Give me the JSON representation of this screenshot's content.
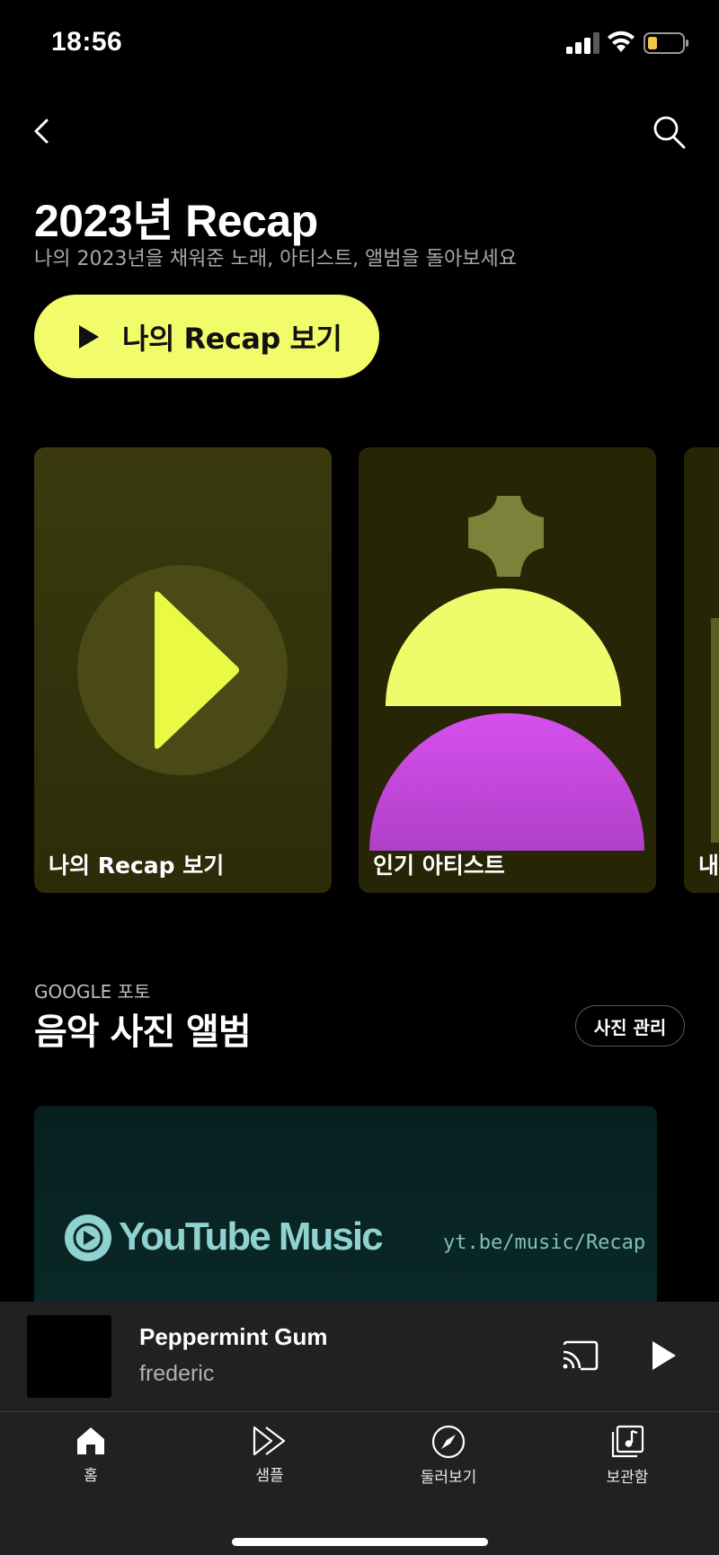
{
  "status_bar": {
    "time": "18:56"
  },
  "header": {
    "title": "2023년 Recap",
    "subtitle": "나의 2023년을 채워준 노래, 아티스트, 앨범을 돌아보세요",
    "cta_label": "나의 Recap 보기"
  },
  "cards": [
    {
      "label": "나의 Recap 보기"
    },
    {
      "label": "인기 아티스트"
    },
    {
      "label": "내"
    }
  ],
  "photos_section": {
    "eyebrow": "GOOGLE 포토",
    "title": "음악 사진 앨범",
    "manage_label": "사진 관리",
    "banner_wordmark": "YouTube Music",
    "banner_url": "yt.be/music/Recap"
  },
  "mini_player": {
    "title": "Peppermint Gum",
    "artist": "frederic"
  },
  "bottom_nav": [
    {
      "label": "홈",
      "icon": "home-icon"
    },
    {
      "label": "샘플",
      "icon": "samples-icon"
    },
    {
      "label": "둘러보기",
      "icon": "explore-icon"
    },
    {
      "label": "보관함",
      "icon": "library-icon"
    }
  ],
  "colors": {
    "accent": "#f2fc6a",
    "magenta": "#d84fe8",
    "olive": "#7b833a",
    "banner_text": "#8fd2d0"
  }
}
